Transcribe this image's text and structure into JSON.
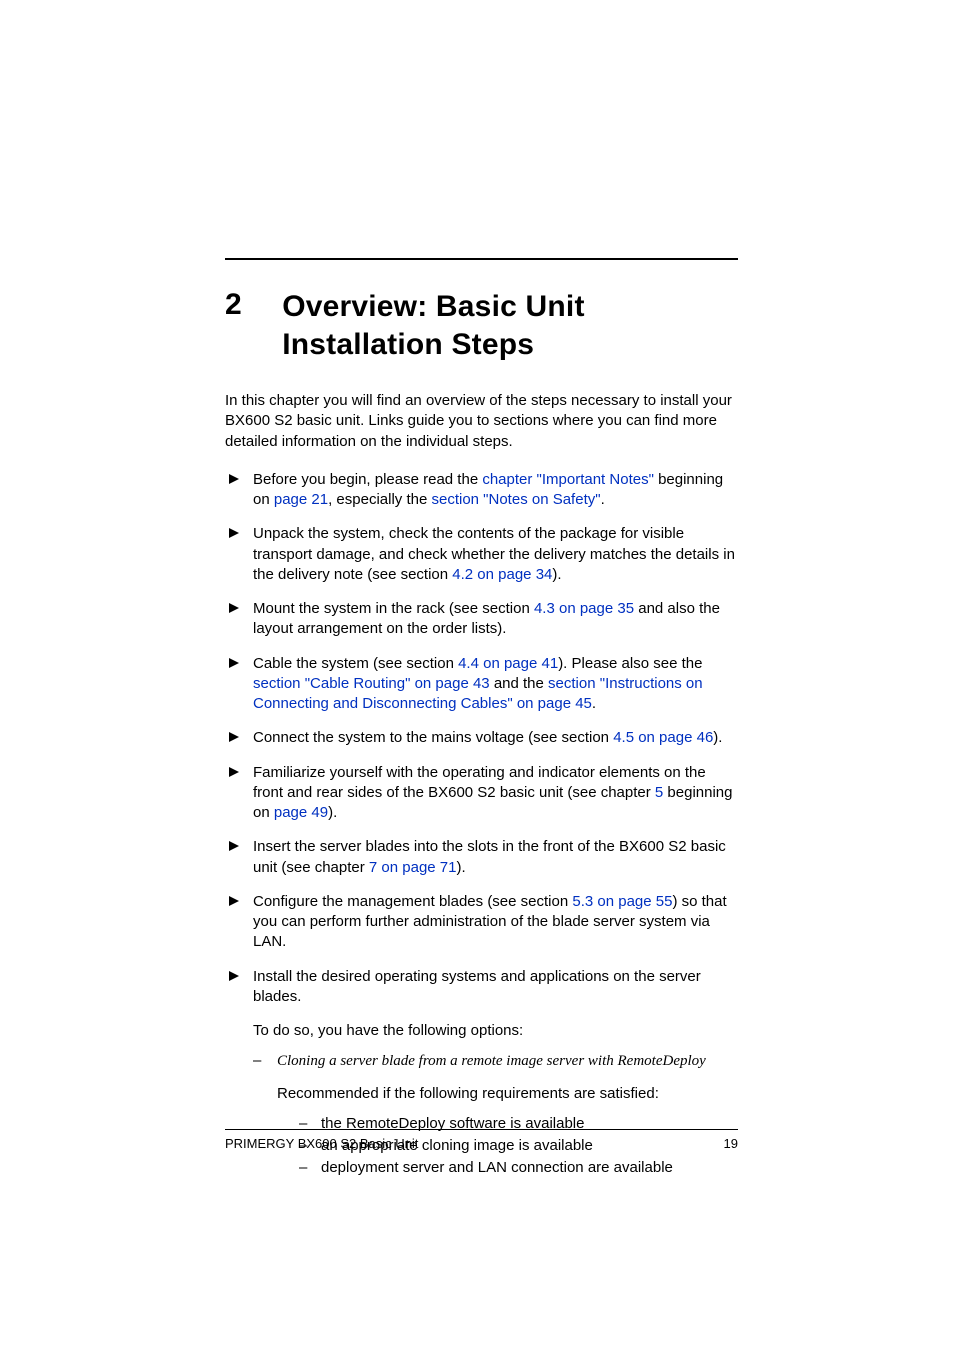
{
  "chapter": {
    "number": "2",
    "title": "Overview: Basic Unit Installation Steps"
  },
  "intro": "In this chapter you will find an overview of the steps necessary to install your BX600 S2 basic unit. Links guide you to sections where you can find more detailed information on the individual steps.",
  "steps": {
    "s1": {
      "t1": "Before you begin, please read the ",
      "l1": "chapter \"Important Notes\"",
      "t2": " beginning on ",
      "l2": "page 21",
      "t3": ", especially the ",
      "l3": "section \"Notes on Safety\"",
      "t4": "."
    },
    "s2": {
      "t1": "Unpack the system, check the contents of the package for visible transport damage, and check whether the delivery matches the details in the delivery note (see section ",
      "l1": "4.2 on page 34",
      "t2": ")."
    },
    "s3": {
      "t1": "Mount the system in the rack (see section ",
      "l1": "4.3 on page 35",
      "t2": " and also the layout arrangement on the order lists)."
    },
    "s4": {
      "t1": "Cable the system (see section ",
      "l1": "4.4 on page 41",
      "t2": "). Please also see the ",
      "l2": "section \"Cable Routing\" on page 43",
      "t3": " and the ",
      "l3": "section \"Instructions on Connecting and Disconnecting Cables\" on page 45",
      "t4": "."
    },
    "s5": {
      "t1": "Connect the system to the mains voltage (see section ",
      "l1": "4.5 on page 46",
      "t2": ")."
    },
    "s6": {
      "t1": "Familiarize yourself with the operating and indicator elements on the front and rear sides of the BX600 S2 basic unit (see chapter ",
      "l1": "5",
      "t2": " beginning on ",
      "l2": "page 49",
      "t3": ")."
    },
    "s7": {
      "t1": "Insert the server blades into the slots in the front of the BX600 S2 basic unit (see chapter ",
      "l1": "7 on page 71",
      "t2": ")."
    },
    "s8": {
      "t1": "Configure the management blades (see section ",
      "l1": "5.3 on page 55",
      "t2": ") so that you can perform further administration of the blade server system via LAN."
    },
    "s9": {
      "t1": "Install the desired operating systems and applications on the server blades."
    }
  },
  "sub_intro": "To do so, you have the following options:",
  "option": {
    "title": "Cloning a server blade from a remote image server with RemoteDeploy",
    "desc": "Recommended if the following requirements are satisfied:",
    "reqs": {
      "r1": "the RemoteDeploy software is available",
      "r2": "an appropriate cloning image is available",
      "r3": "deployment server and LAN connection are available"
    }
  },
  "footer": {
    "doc": "PRIMERGY BX600 S2 Basic Unit",
    "page": "19"
  }
}
